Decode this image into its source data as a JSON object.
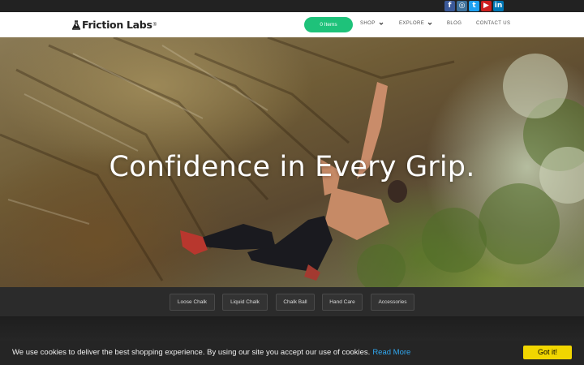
{
  "social": {
    "facebook": {
      "icon": "facebook-icon",
      "glyph": "f",
      "color": "#3b5998"
    },
    "instagram": {
      "icon": "instagram-icon",
      "glyph": "◎",
      "color": "#3f729b"
    },
    "twitter": {
      "icon": "twitter-icon",
      "glyph": "t",
      "color": "#1da1f2"
    },
    "youtube": {
      "icon": "youtube-icon",
      "glyph": "▶",
      "color": "#cd201f"
    },
    "linkedin": {
      "icon": "linkedin-icon",
      "glyph": "in",
      "color": "#0077b5"
    }
  },
  "header": {
    "logo_text": "Friction Labs",
    "logo_reg": "®",
    "cart_label": "0 Items",
    "cart_color": "#1ec27a",
    "nav": {
      "shop": "SHOP",
      "explore": "EXPLORE",
      "blog": "BLOG",
      "contact": "CONTACT US"
    }
  },
  "hero": {
    "title": "Confidence in Every Grip."
  },
  "categories": {
    "loose_chalk": "Loose Chalk",
    "liquid_chalk": "Liquid Chalk",
    "chalk_ball": "Chalk Ball",
    "hand_care": "Hand Care",
    "accessories": "Accessories"
  },
  "cookie": {
    "message": "We use cookies to deliver the best shopping experience. By using our site you accept our use of cookies.",
    "link": "Read More",
    "button": "Got it!",
    "button_color": "#f1d600",
    "link_color": "#31a8f0"
  }
}
